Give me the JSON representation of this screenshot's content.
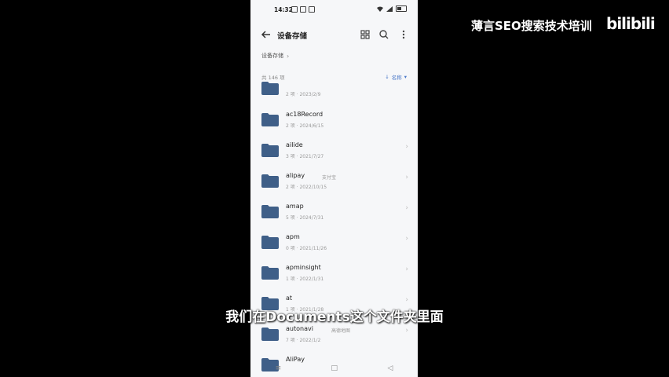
{
  "watermark": {
    "brand": "薄言SEO搜索技术培训",
    "logo": "bilibili"
  },
  "subtitle": "我们在Documents这个文件夹里面",
  "status_bar": {
    "time": "14:32"
  },
  "app_bar": {
    "title": "设备存储"
  },
  "breadcrumb": {
    "item": "设备存储",
    "separator": "›"
  },
  "list_header": {
    "count": "共 146 项",
    "sort_label": "名称"
  },
  "folders": [
    {
      "name": "",
      "meta": "2 项 · 2023/2/9",
      "tag": ""
    },
    {
      "name": "ac18Record",
      "meta": "2 项 · 2024/6/15",
      "tag": ""
    },
    {
      "name": "aiIide",
      "meta": "3 项 · 2021/7/27",
      "tag": ""
    },
    {
      "name": "alipay",
      "meta": "2 项 · 2022/10/15",
      "tag": "支付宝"
    },
    {
      "name": "amap",
      "meta": "5 项 · 2024/7/31",
      "tag": ""
    },
    {
      "name": "apm",
      "meta": "0 项 · 2021/11/26",
      "tag": ""
    },
    {
      "name": "apminsight",
      "meta": "1 项 · 2022/1/31",
      "tag": ""
    },
    {
      "name": "at",
      "meta": "1 项 · 2021/1/28",
      "tag": ""
    },
    {
      "name": "autonavi",
      "meta": "7 项 · 2022/1/2",
      "tag": "高德地图"
    },
    {
      "name": "AliPay",
      "meta": "",
      "tag": ""
    }
  ],
  "colors": {
    "folder": "#3f5f88",
    "accent": "#4a78c8"
  },
  "icons": [
    "back-arrow-icon",
    "grid-view-icon",
    "search-icon",
    "more-vert-icon",
    "folder-icon",
    "chevron-right-icon",
    "sort-arrow-icon"
  ]
}
